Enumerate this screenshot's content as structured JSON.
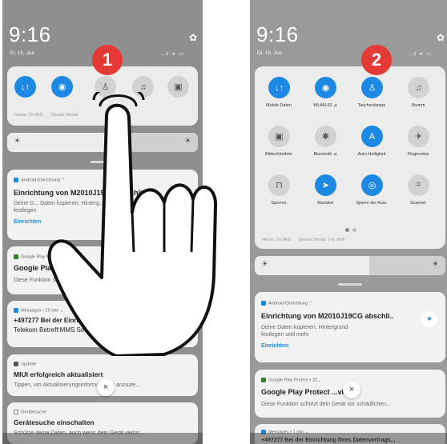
{
  "left": {
    "time": "9:16",
    "date": "Di. 15. Jun",
    "status_icons": "..ıl ᯤ ▭",
    "data_usage": "Heute: 29,9KB",
    "data_month": "Diesen Monat",
    "step_number": "1",
    "notifications": [
      {
        "app": "Android-Einrichtung ⌃",
        "title": "Einrichtung von M2010J19CG abschli",
        "body1": "Deine D... Daten kopieren, Hinterg...",
        "body2": "festlegen",
        "link": "Einrichten"
      },
      {
        "app": "Google Play Protect",
        "title": "Google Play Protect",
        "body1": "Diese Funktion schützt..."
      },
      {
        "app": "Messages • 29 min ⌄",
        "title": "+497277 Bei der Einrichtung",
        "body1": "Telekom Betreff:MMS Service"
      },
      {
        "app": "Updater",
        "title": "MIUI erfolgreich aktualisiert",
        "body1": "Tippen, um Aktualisierungsinformationen anzuzei..."
      },
      {
        "app": "Gerätesuche",
        "title": "Gerätesuche einschalten",
        "body1": "Schütze deine Daten, auch wenn dein Gerät verlor..."
      }
    ]
  },
  "right": {
    "time": "9:16",
    "date": "Di. 15. Jun",
    "status_icons": "..ıl ᯤ ▭",
    "step_number": "2",
    "tiles": [
      {
        "label": "Mobile Daten",
        "icon": "↓↑",
        "on": true
      },
      {
        "label": "WLAN-92 ⊿",
        "icon": "◉",
        "on": true
      },
      {
        "label": "Taschenlampe",
        "icon": "♙",
        "on": true
      },
      {
        "label": "Stumm",
        "icon": "♫",
        "on": false
      },
      {
        "label": "Bildschirmfoto",
        "icon": "▣",
        "on": false
      },
      {
        "label": "Bluetooth ⊿",
        "icon": "✱",
        "on": false
      },
      {
        "label": "Auto-Helligkeit",
        "icon": "A",
        "on": true
      },
      {
        "label": "Flugmodus",
        "icon": "✈",
        "on": false
      },
      {
        "label": "Sperren",
        "icon": "⊓",
        "on": false
      },
      {
        "label": "Standort",
        "icon": "➤",
        "on": true
      },
      {
        "label": "Sperre der Ausr.",
        "icon": "◎",
        "on": true
      },
      {
        "label": "Scanner",
        "icon": "⌗",
        "on": false
      }
    ],
    "data_usage": "Heute: 29,9KB",
    "data_month": "Diesen Monat: 141,6KB",
    "notifications": [
      {
        "app": "Android-Einrichtung ⌃",
        "title": "Einrichtung von M2010J19CG abschli..",
        "body1": "Deine Daten kopieren, Hintergrund",
        "body2": "festlegen und mehr",
        "link": "Einrichten"
      },
      {
        "app": "Google Play Protect • 22...",
        "title": "Google Play Protect ...viert",
        "body1": "Diese Funktion schützt dein Gerät vor schädlichen..."
      },
      {
        "app": "Messages • 1 min ⌄",
        "title": "+497277 Bei der Einrichtung Ihres Datenvertrags..."
      }
    ]
  },
  "close_symbol": "×",
  "gear_symbol": "✿",
  "sun_symbol": "☀"
}
